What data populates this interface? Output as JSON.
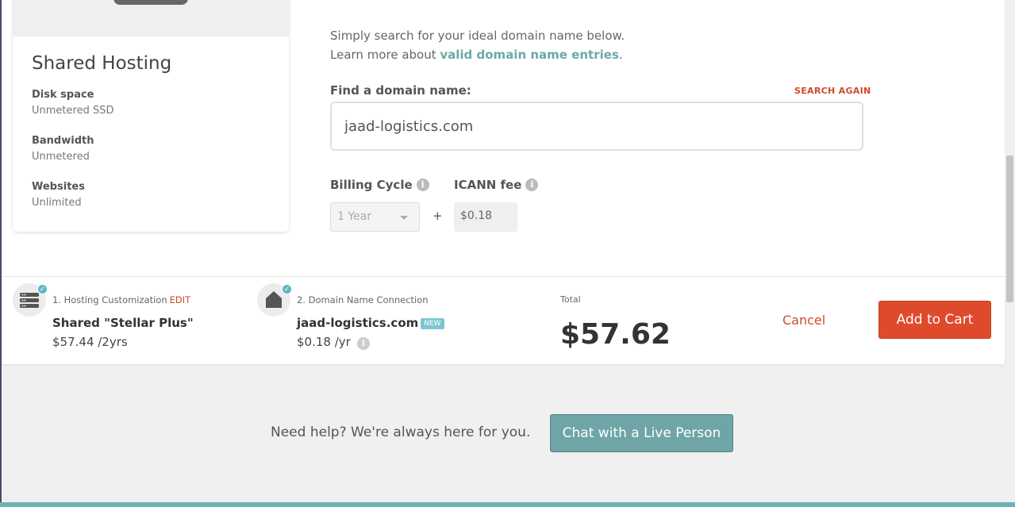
{
  "hosting_card": {
    "title": "Shared Hosting",
    "specs": [
      {
        "label": "Disk space",
        "value": "Unmetered SSD"
      },
      {
        "label": "Bandwidth",
        "value": "Unmetered"
      },
      {
        "label": "Websites",
        "value": "Unlimited"
      }
    ]
  },
  "search": {
    "intro_line1": "Simply search for your ideal domain name below.",
    "intro_line2_prefix": "Learn more about ",
    "intro_link": "valid domain name entries",
    "intro_line2_suffix": ".",
    "find_label": "Find a domain name:",
    "search_again": "SEARCH AGAIN",
    "domain_value": "jaad-logistics.com"
  },
  "billing": {
    "cycle_label": "Billing Cycle",
    "cycle_value": "1 Year",
    "plus": "+",
    "icann_label": "ICANN fee",
    "icann_value": "$0.18",
    "info_glyph": "i"
  },
  "summary": {
    "step1_title": "1. Hosting Customization",
    "step1_edit": "EDIT",
    "step1_name": "Shared \"Stellar Plus\"",
    "step1_price": "$57.44 /2yrs",
    "step2_title": "2. Domain Name Connection",
    "step2_name": "jaad-logistics.com",
    "step2_badge": "NEW",
    "step2_price": "$0.18 /yr",
    "total_label": "Total",
    "total_value": "$57.62",
    "cancel": "Cancel",
    "add_to_cart": "Add to Cart",
    "check_glyph": "✓"
  },
  "help": {
    "text": "Need help? We're always here for you.",
    "chat_button": "Chat with a Live Person"
  },
  "colors": {
    "accent_red": "#df4a2c",
    "teal": "#6fa5a7",
    "link_teal": "#6aa9a9",
    "badge_teal": "#7cc7cf"
  },
  "icons": [
    "server-icon",
    "home-icon",
    "check-icon",
    "info-icon",
    "chevron-down-icon"
  ]
}
